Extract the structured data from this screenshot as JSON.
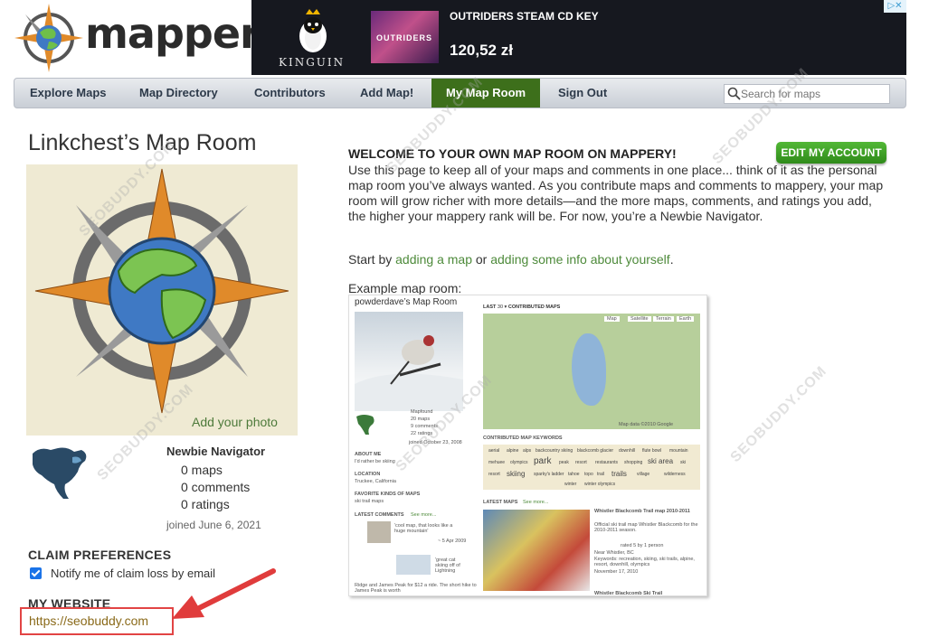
{
  "logo": {
    "text": "mappery"
  },
  "ad": {
    "brand": "KINGUIN",
    "product_thumb_text": "OUTRIDERS",
    "title": "OUTRIDERS STEAM CD KEY",
    "price": "120,52 zł"
  },
  "nav": {
    "items": [
      "Explore Maps",
      "Map Directory",
      "Contributors",
      "Add Map!",
      "My Map Room",
      "Sign Out"
    ],
    "active": "My Map Room",
    "search_placeholder": "Search for maps"
  },
  "profile": {
    "room_title": "Linkchest’s Map Room",
    "add_photo": "Add your photo",
    "rank": "Newbie Navigator",
    "maps": "0 maps",
    "comments": "0 comments",
    "ratings": "0 ratings",
    "joined": "joined June 6, 2021"
  },
  "claim": {
    "heading": "CLAIM PREFERENCES",
    "notify_label": "Notify me of claim loss by email",
    "notify_checked": true
  },
  "website": {
    "heading": "MY WEBSITE",
    "url": "https://seobuddy.com"
  },
  "welcome": {
    "heading": "WELCOME TO YOUR OWN MAP ROOM ON MAPPERY!",
    "edit_button": "EDIT MY ACCOUNT",
    "intro": "Use this page to keep all of your maps and comments in one place... think of it as the personal map room you’ve always wanted. As you contribute maps and comments to mappery, your map room will grow richer with more details—and the more maps, comments, and ratings you add, the higher your mappery rank will be. For now, you’re a Newbie Navigator.",
    "start_prefix": "Start by ",
    "link_add_map": "adding a map",
    "start_mid": " or ",
    "link_add_info": "adding some info about yourself",
    "start_suffix": ".",
    "example_label": "Example map room:"
  },
  "example": {
    "title": "powderdave’s Map Room",
    "last_label": "LAST",
    "last_value": "30",
    "contributed_label": "CONTRIBUTED MAPS",
    "rank": "Mapfound",
    "maps": "20 maps",
    "comments": "9 comments",
    "ratings": "22 ratings",
    "joined": "joined October 23, 2008",
    "about_me_h": "ABOUT ME",
    "about_me": "I'd rather be skiing",
    "location_h": "LOCATION",
    "location": "Truckee, California",
    "favorite_h": "FAVORITE KINDS OF MAPS",
    "favorite": "ski trail maps",
    "latest_comments_h": "LATEST COMMENTS",
    "see_more": "See more...",
    "comment1": "'cool map, that looks like a huge mountain'",
    "comment1_date": "~ 5 Apr 2009",
    "comment2": "'great cat skiing off of Lightning",
    "comment3": "Ridge and James Peak for $12 a ride. The short hike to James Peak is worth",
    "keywords_h": "CONTRIBUTED MAP KEYWORDS",
    "keywords": [
      "aerial",
      "alpine",
      "alps",
      "backcountry skiing",
      "blackcomb glacier",
      "downhill",
      "flute bowl",
      "mountain",
      "mehuee",
      "olympics",
      "park",
      "peak",
      "resort",
      "restaurants",
      "shopping",
      "ski area",
      "ski",
      "resort",
      "skiing",
      "sparky's ladder",
      "tahoe",
      "topo",
      "trail",
      "trails",
      "village",
      "wilderness",
      "winter",
      "winter olympics"
    ],
    "latest_maps_h": "LATEST MAPS",
    "latest_map_title": "Whistler Blackcomb Trail map 2010-2011",
    "latest_map_desc": "Official ski trail map Whistler Blackcomb for the 2010-2011 season.",
    "latest_map_rated": "rated 5 by 1 person",
    "latest_map_near": "Near Whistler, BC",
    "latest_map_kw": "Keywords: recreation, skiing, ski trails, alpine, resort, downhill, olympics",
    "latest_map_date": "November 17, 2010",
    "latest_map2_title": "Whistler Blackcomb Ski Trail",
    "map_tabs": [
      "Map",
      "Satellite",
      "Terrain",
      "Earth"
    ],
    "map_credit": "Map data ©2010 Google"
  },
  "watermark": "SEOBUDDY.COM",
  "colors": {
    "nav_active_bg": "#3d6f1b",
    "link_green": "#4d8a3a",
    "edit_button": "#3f9d27",
    "highlight_red": "#e24444",
    "photo_bg": "#efead3"
  },
  "icons": [
    "compass-logo-icon",
    "kinguin-penguin-icon",
    "search-icon",
    "compass-globe-icon",
    "north-america-map-icon",
    "checkbox-checked-icon",
    "red-arrow-icon"
  ]
}
